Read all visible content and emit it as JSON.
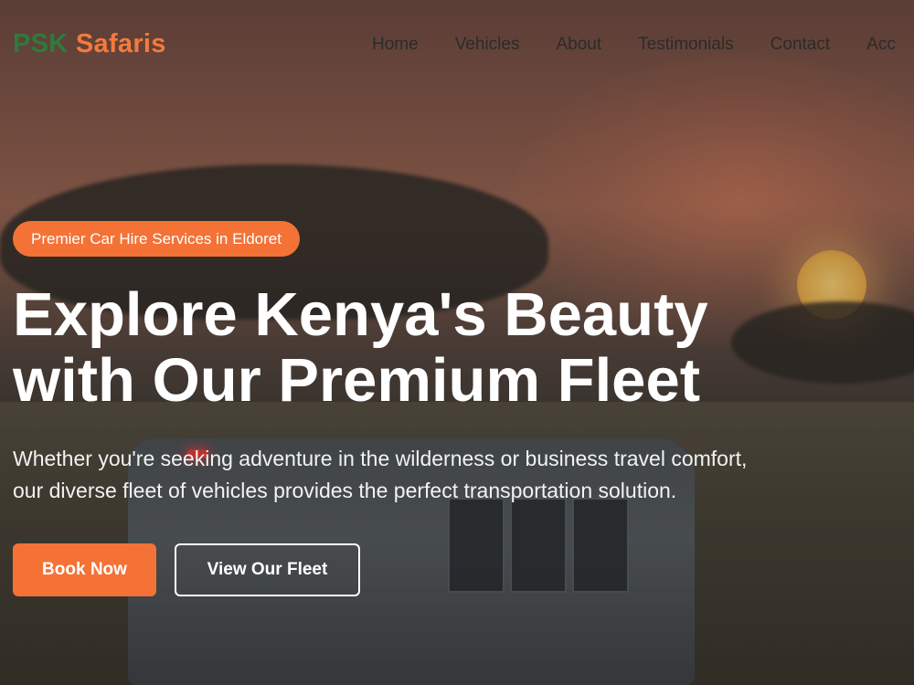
{
  "brand": {
    "part1": "PSK",
    "part2": "Safaris",
    "color_primary": "#2f7a3c",
    "color_accent": "#f57a3c"
  },
  "nav": {
    "items": [
      {
        "label": "Home"
      },
      {
        "label": "Vehicles"
      },
      {
        "label": "About"
      },
      {
        "label": "Testimonials"
      },
      {
        "label": "Contact"
      },
      {
        "label": "Acc"
      }
    ]
  },
  "hero": {
    "badge": "Premier Car Hire Services in Eldoret",
    "headline_line1": "Explore Kenya's Beauty",
    "headline_line2": "with Our Premium Fleet",
    "subtext": "Whether you're seeking adventure in the wilderness or business travel comfort, our diverse fleet of vehicles provides the perfect transportation solution.",
    "primary_button": "Book Now",
    "secondary_button": "View Our Fleet",
    "accent_color": "#f47236"
  }
}
